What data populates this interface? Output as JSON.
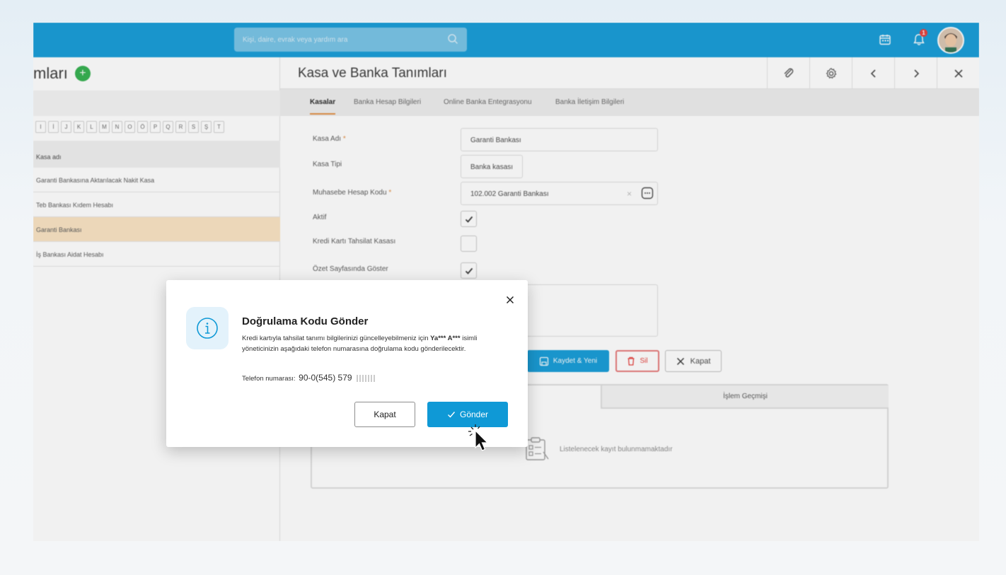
{
  "topbar": {
    "search_placeholder": "Kişi, daire, evrak veya yardım ara",
    "notification_count": "1"
  },
  "left_panel": {
    "title": "mları",
    "letters": [
      "I",
      "İ",
      "J",
      "K",
      "L",
      "M",
      "N",
      "O",
      "Ö",
      "P",
      "Q",
      "R",
      "S",
      "Ş",
      "T"
    ],
    "column_header": "Kasa adı",
    "rows": [
      "Garanti Bankasına Aktarılacak Nakit Kasa",
      "Teb Bankası Kıdem Hesabı",
      "Garanti Bankası",
      "İş Bankası Aidat Hesabı"
    ]
  },
  "right_panel": {
    "title": "Kasa ve Banka Tanımları",
    "tabs": [
      "Kasalar",
      "Banka Hesap Bilgileri",
      "Online Banka Entegrasyonu",
      "Banka İletişim Bilgileri"
    ],
    "form": {
      "kasa_adi_label": "Kasa Adı",
      "kasa_adi_value": "Garanti Bankası",
      "kasa_tipi_label": "Kasa Tipi",
      "kasa_tipi_value": "Banka kasası",
      "muhasebe_label": "Muhasebe Hesap Kodu",
      "muhasebe_value": "102.002  Garanti Bankası",
      "aktif_label": "Aktif",
      "kredi_karti_label": "Kredi Kartı Tahsilat Kasası",
      "ozet_label": "Özet Sayfasında Göster",
      "required_mark": "*"
    },
    "buttons": {
      "save_new": "Kaydet & Yeni",
      "delete": "Sil",
      "close": "Kapat"
    },
    "history_tab": "İşlem Geçmişi",
    "empty_message": "Listelenecek kayıt bulunmamaktadır"
  },
  "dialog": {
    "title": "Doğrulama Kodu Gönder",
    "text_before": "Kredi kartıyla tahsilat tanımı bilgilerinizi güncelleyebilmeniz için ",
    "manager_name": "Ya*** A***",
    "text_after": " isimli yöneticinizin aşağıdaki telefon numarasına doğrulama kodu gönderilecektir.",
    "phone_label": "Telefon numarası:",
    "phone_value": "90-0(545) 579",
    "cancel_label": "Kapat",
    "send_label": "Gönder"
  },
  "colors": {
    "brand_blue": "#0f99d6",
    "accent_orange": "#e08a3c",
    "selected_row": "#fae3c1",
    "delete_red": "#e53935"
  }
}
